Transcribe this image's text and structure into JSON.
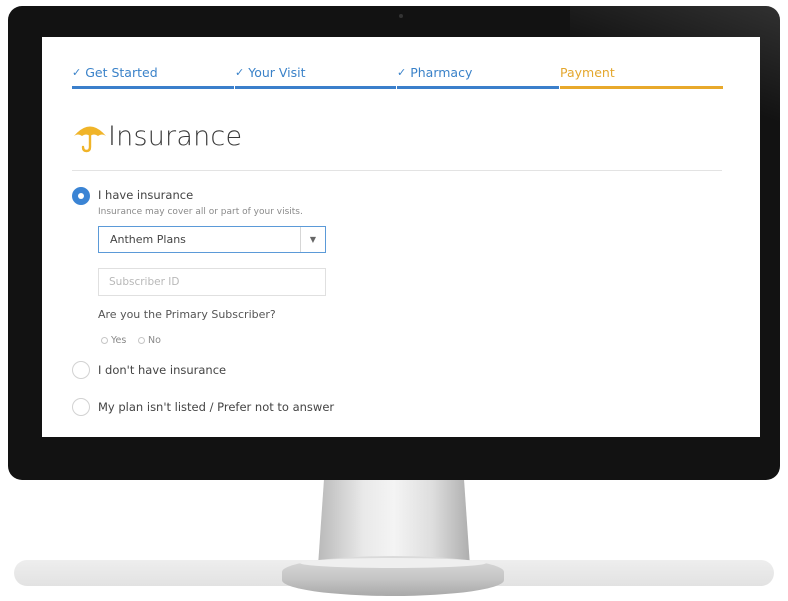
{
  "steps": [
    {
      "label": "Get Started",
      "done": true
    },
    {
      "label": "Your Visit",
      "done": true
    },
    {
      "label": "Pharmacy",
      "done": true
    },
    {
      "label": "Payment",
      "done": false
    }
  ],
  "page": {
    "title": "Insurance",
    "icon": "umbrella-icon"
  },
  "colors": {
    "accent_blue": "#3b7fcb",
    "accent_orange": "#e8a92b",
    "umbrella": "#f0b429"
  },
  "options": {
    "have_insurance": {
      "label": "I have insurance",
      "hint": "Insurance may cover all or part of your visits.",
      "selected": true
    },
    "no_insurance": {
      "label": "I don't have insurance",
      "selected": false
    },
    "not_listed": {
      "label": "My plan isn't listed / Prefer not to answer",
      "selected": false
    }
  },
  "plan_select": {
    "value": "Anthem Plans",
    "icon": "chevron-down-icon"
  },
  "subscriber_id": {
    "placeholder": "Subscriber ID",
    "value": ""
  },
  "primary_question": {
    "text": "Are you the Primary Subscriber?",
    "yes_label": "Yes",
    "no_label": "No"
  }
}
